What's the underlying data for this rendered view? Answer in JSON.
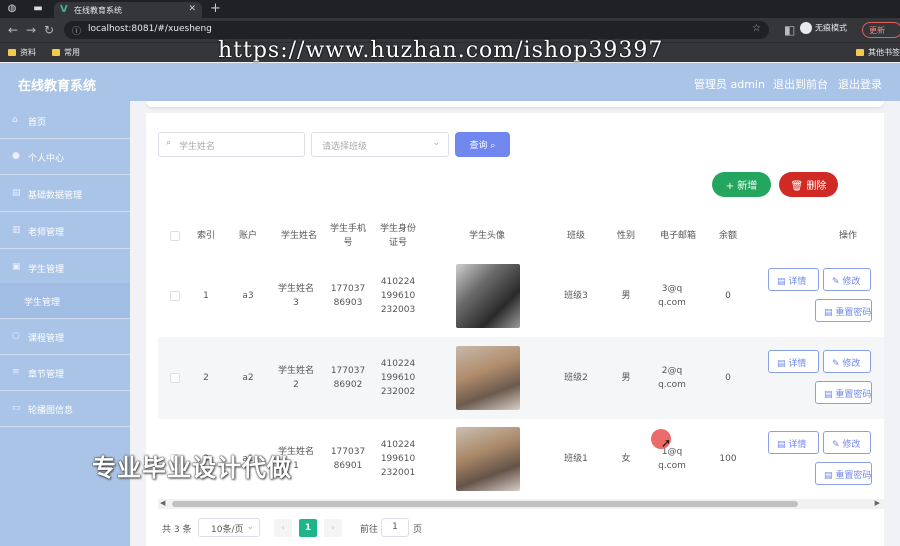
{
  "browser": {
    "tab_title": "在线教育系统",
    "url": "localhost:8081/#/xuesheng",
    "incognito_label": "无痕模式",
    "update_label": "更新",
    "bookmarks": [
      "资料",
      "常用",
      "其他书签"
    ]
  },
  "watermarks": {
    "top": "https://www.huzhan.com/ishop39397",
    "bottom": "专业毕业设计代做"
  },
  "header": {
    "title": "在线教育系统",
    "admin": "管理员 admin",
    "back_to_front": "退出到前台",
    "logout": "退出登录"
  },
  "sidebar": {
    "items": [
      {
        "label": "首页",
        "icon": "home-icon"
      },
      {
        "label": "个人中心",
        "icon": "user-icon"
      },
      {
        "label": "基础数据管理",
        "icon": "data-icon"
      },
      {
        "label": "老师管理",
        "icon": "teacher-icon"
      },
      {
        "label": "学生管理",
        "icon": "student-icon"
      },
      {
        "label": "学生管理",
        "icon": ""
      },
      {
        "label": "课程管理",
        "icon": "course-icon"
      },
      {
        "label": "章节管理",
        "icon": "list-icon"
      },
      {
        "label": "轮播图信息",
        "icon": "image-icon"
      }
    ]
  },
  "filters": {
    "name_placeholder": "学生姓名",
    "class_placeholder": "请选择班级",
    "query_label": "查询"
  },
  "actions": {
    "add_label": "新增",
    "delete_label": "删除"
  },
  "table": {
    "headers": [
      "索引",
      "账户",
      "学生姓名",
      "学生手机号",
      "学生身份证号",
      "学生头像",
      "班级",
      "性别",
      "电子邮箱",
      "余额",
      "操作"
    ],
    "rows": [
      {
        "index": "1",
        "account": "a3",
        "name": "学生姓名3",
        "phone": "17703786903",
        "id_card": "410224199610232003",
        "class": "班级3",
        "gender": "男",
        "email": "3@qq.com",
        "balance": "0"
      },
      {
        "index": "2",
        "account": "a2",
        "name": "学生姓名2",
        "phone": "17703786902",
        "id_card": "410224199610232002",
        "class": "班级2",
        "gender": "男",
        "email": "2@qq.com",
        "balance": "0"
      },
      {
        "index": "3",
        "account": "a1",
        "name": "学生姓名1",
        "phone": "17703786901",
        "id_card": "410224199610232001",
        "class": "班级1",
        "gender": "女",
        "email": "1@qq.com",
        "balance": "100"
      }
    ],
    "op_labels": {
      "detail": "详情",
      "edit": "修改",
      "reset": "重置密码"
    }
  },
  "pagination": {
    "total": "共 3 条",
    "page_size": "10条/页",
    "current": "1",
    "goto_label": "前往",
    "goto_value": "1",
    "page_label": "页"
  }
}
